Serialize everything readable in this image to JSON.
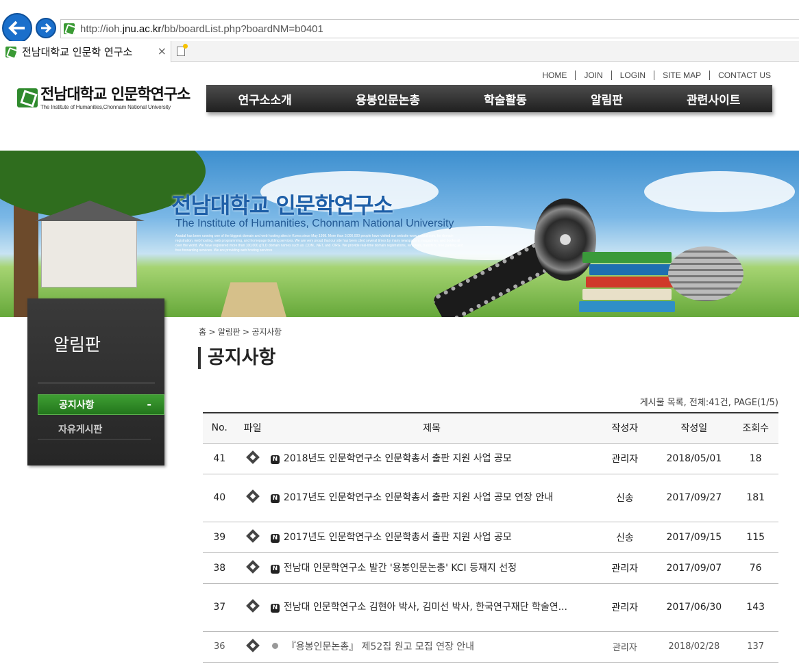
{
  "browser": {
    "url_prefix": "http://ioh.",
    "url_domain": "jnu.ac.kr",
    "url_path": "/bb/boardList.php?boardNM=b0401",
    "tab_title": "전남대학교 인문학 연구소",
    "tab_close": "×"
  },
  "site": {
    "logo_title": "전남대학교 인문학연구소",
    "logo_subtitle": "The Institute of Humanities,Chonnam National University",
    "util_links": [
      "HOME",
      "JOIN",
      "LOGIN",
      "SITE MAP",
      "CONTACT US"
    ],
    "gnb": [
      "연구소소개",
      "용봉인문논총",
      "학술활동",
      "알림판",
      "관련사이트"
    ]
  },
  "banner": {
    "title": "전남대학교 인문학연구소",
    "subtitle": "The Institute of Humanities, Chonnam National University",
    "body": "Asadal has been running one of the biggest domain and web hosting sites in Korea since May 1998. More than 3,000,000 people have visited our website www.asadal.com, for domain registration, web hosting, web programming, and homepage building services. We are very proud that our site has been cited several times by many newspapers, magazines, and books all over the world. We have registered more than 100,000 gTLD domain names such as .COM, .NET, and .ORG. We provide real-time domain registrations, renewals, transfers, free parking and free forwarding services. We are providing web hosting services"
  },
  "sidebar": {
    "title": "알림판",
    "items": [
      {
        "label": "공지사항",
        "marker": "-"
      },
      {
        "label": "자유게시판"
      }
    ]
  },
  "content": {
    "breadcrumb": "홈 > 알림판 > 공지사항",
    "title": "공지사항",
    "summary": "게시물 목록, 전체:41건, PAGE(1/5)",
    "columns": [
      "No.",
      "파일",
      "제목",
      "작성자",
      "작성일",
      "조회수"
    ],
    "notice_badge": "N",
    "rows": [
      {
        "no": "41",
        "title": "2018년도 인문학연구소 인문학총서 출판 지원 사업 공모",
        "author": "관리자",
        "date": "2018/05/01",
        "views": "18"
      },
      {
        "no": "40",
        "title": "2017년도 인문학연구소 인문학총서 출판 지원 사업 공모 연장 안내",
        "author": "신송",
        "date": "2017/09/27",
        "views": "181"
      },
      {
        "no": "39",
        "title": "2017년도 인문학연구소 인문학총서 출판 지원 사업 공모",
        "author": "신송",
        "date": "2017/09/15",
        "views": "115"
      },
      {
        "no": "38",
        "title": "전남대 인문학연구소 발간 '용봉인문논총' KCI 등재지 선정",
        "author": "관리자",
        "date": "2017/09/07",
        "views": "76"
      },
      {
        "no": "37",
        "title": "전남대 인문학연구소 김현아 박사, 김미선 박사, 한국연구재단 학술연...",
        "author": "관리자",
        "date": "2017/06/30",
        "views": "143"
      },
      {
        "no": "36",
        "title": "『용봉인문논총』 제52집 원고 모집 연장 안내",
        "author": "관리자",
        "date": "2018/02/28",
        "views": "137"
      }
    ]
  }
}
